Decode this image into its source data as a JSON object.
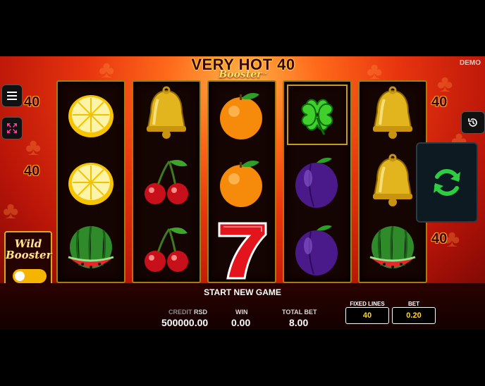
{
  "game": {
    "title_line1": "VERY HOT 40",
    "title_line2": "Booster",
    "trademark": "™",
    "demo_label": "DEMO"
  },
  "controls": {
    "menu_icon": "hamburger-menu-icon",
    "fullscreen_icon": "fullscreen-arrows-icon",
    "history_icon": "history-clock-icon",
    "spin_icon": "refresh-spin-icon"
  },
  "paylines": {
    "left": [
      "40",
      "40",
      "40"
    ],
    "right": [
      "40",
      "40"
    ]
  },
  "reels": [
    [
      "lemon",
      "lemon",
      "watermelon"
    ],
    [
      "bell",
      "cherries",
      "cherries"
    ],
    [
      "orange",
      "orange",
      "seven"
    ],
    [
      "clover",
      "plum",
      "plum"
    ],
    [
      "bell",
      "bell",
      "watermelon"
    ]
  ],
  "wild_booster": {
    "title": "Wild Booster",
    "enabled": false
  },
  "status": {
    "message": "START NEW GAME"
  },
  "stats": {
    "credit_label": "CREDIT",
    "currency": "RSD",
    "credit_value": "500000.00",
    "win_label": "WIN",
    "win_value": "0.00",
    "total_bet_label": "TOTAL BET",
    "total_bet_value": "8.00"
  },
  "settings": {
    "fixed_lines_label": "FIXED LINES",
    "fixed_lines_value": "40",
    "bet_label": "BET",
    "bet_value": "0.20"
  },
  "colors": {
    "accent_gold": "#d8a820",
    "spin_green": "#2ecc40",
    "value_yellow": "#ffd82a"
  }
}
